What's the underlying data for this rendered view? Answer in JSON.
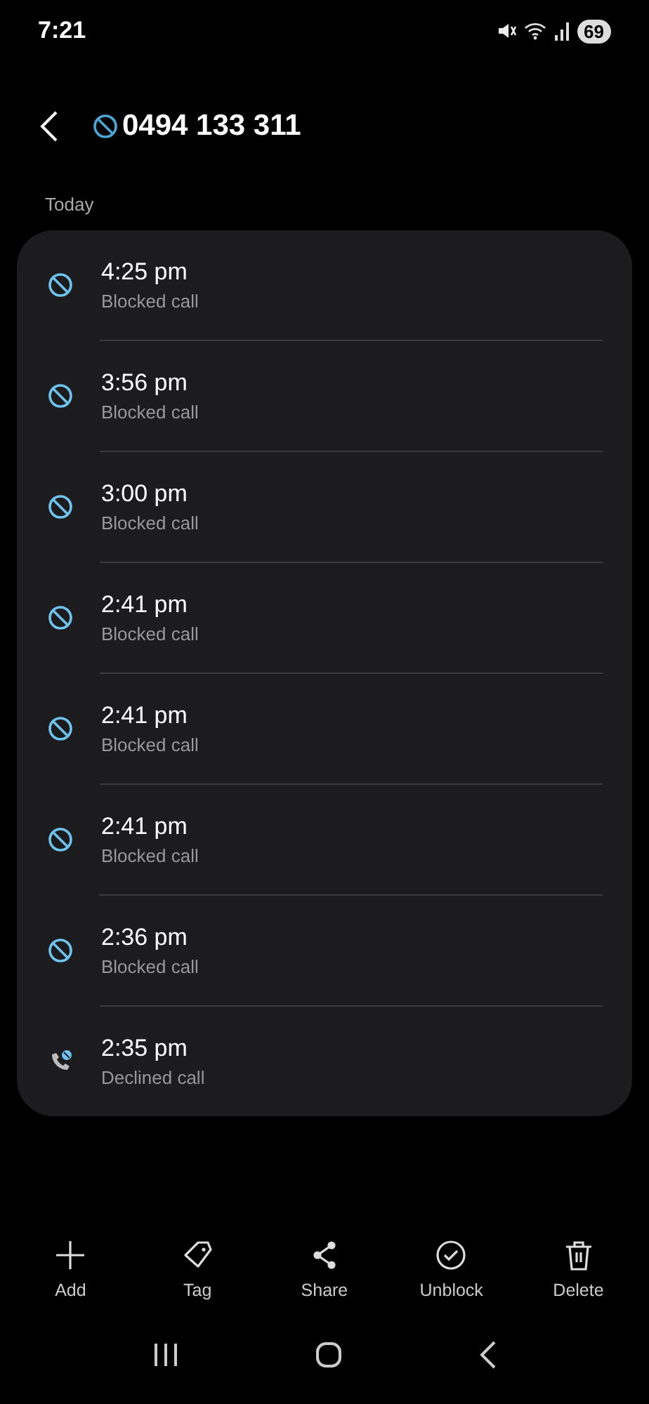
{
  "status_bar": {
    "time": "7:21",
    "battery": "69"
  },
  "header": {
    "number": "0494 133 311"
  },
  "section": "Today",
  "calls": [
    {
      "kind": "blocked",
      "time": "4:25 pm",
      "label": "Blocked call"
    },
    {
      "kind": "blocked",
      "time": "3:56 pm",
      "label": "Blocked call"
    },
    {
      "kind": "blocked",
      "time": "3:00 pm",
      "label": "Blocked call"
    },
    {
      "kind": "blocked",
      "time": "2:41 pm",
      "label": "Blocked call"
    },
    {
      "kind": "blocked",
      "time": "2:41 pm",
      "label": "Blocked call"
    },
    {
      "kind": "blocked",
      "time": "2:41 pm",
      "label": "Blocked call"
    },
    {
      "kind": "blocked",
      "time": "2:36 pm",
      "label": "Blocked call"
    },
    {
      "kind": "declined",
      "time": "2:35 pm",
      "label": "Declined call"
    }
  ],
  "actions": [
    {
      "kind": "add",
      "label": "Add"
    },
    {
      "kind": "tag",
      "label": "Tag"
    },
    {
      "kind": "share",
      "label": "Share"
    },
    {
      "kind": "unblock",
      "label": "Unblock"
    },
    {
      "kind": "delete",
      "label": "Delete"
    }
  ]
}
